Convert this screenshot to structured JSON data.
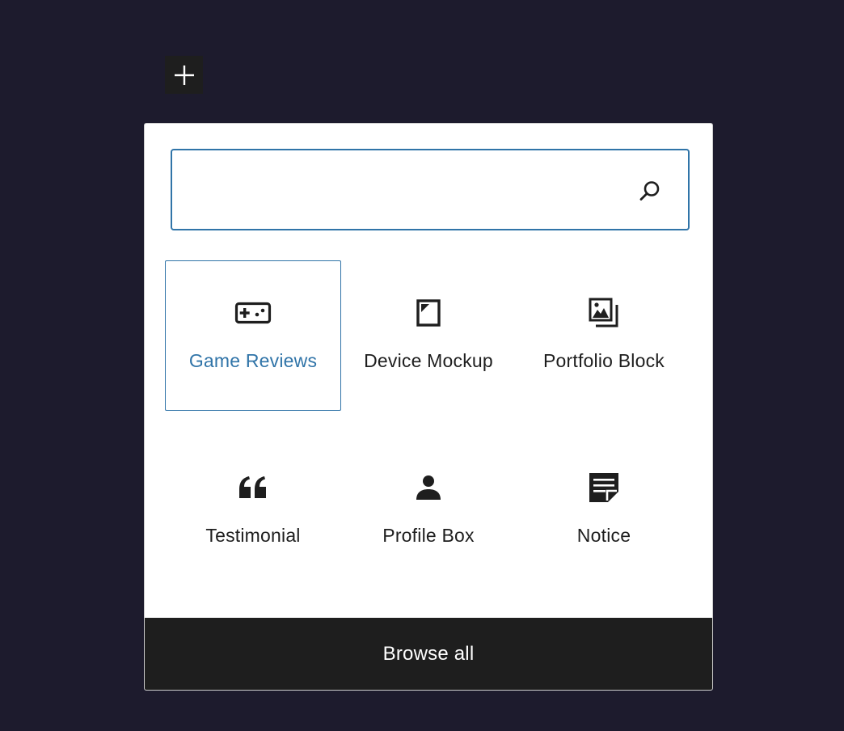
{
  "add_button": {
    "icon": "plus-icon"
  },
  "search": {
    "value": "",
    "placeholder": "",
    "icon": "search-icon"
  },
  "blocks": [
    {
      "label": "Game Reviews",
      "icon": "gamepad-icon",
      "selected": true
    },
    {
      "label": "Device Mockup",
      "icon": "device-icon",
      "selected": false
    },
    {
      "label": "Portfolio Block",
      "icon": "gallery-icon",
      "selected": false
    },
    {
      "label": "Testimonial",
      "icon": "quote-icon",
      "selected": false
    },
    {
      "label": "Profile Box",
      "icon": "person-icon",
      "selected": false
    },
    {
      "label": "Notice",
      "icon": "note-icon",
      "selected": false
    }
  ],
  "browse_all": {
    "label": "Browse all"
  },
  "colors": {
    "background": "#1d1b2d",
    "accent": "#3074a8",
    "dark": "#1e1e1e",
    "panel": "#ffffff"
  }
}
